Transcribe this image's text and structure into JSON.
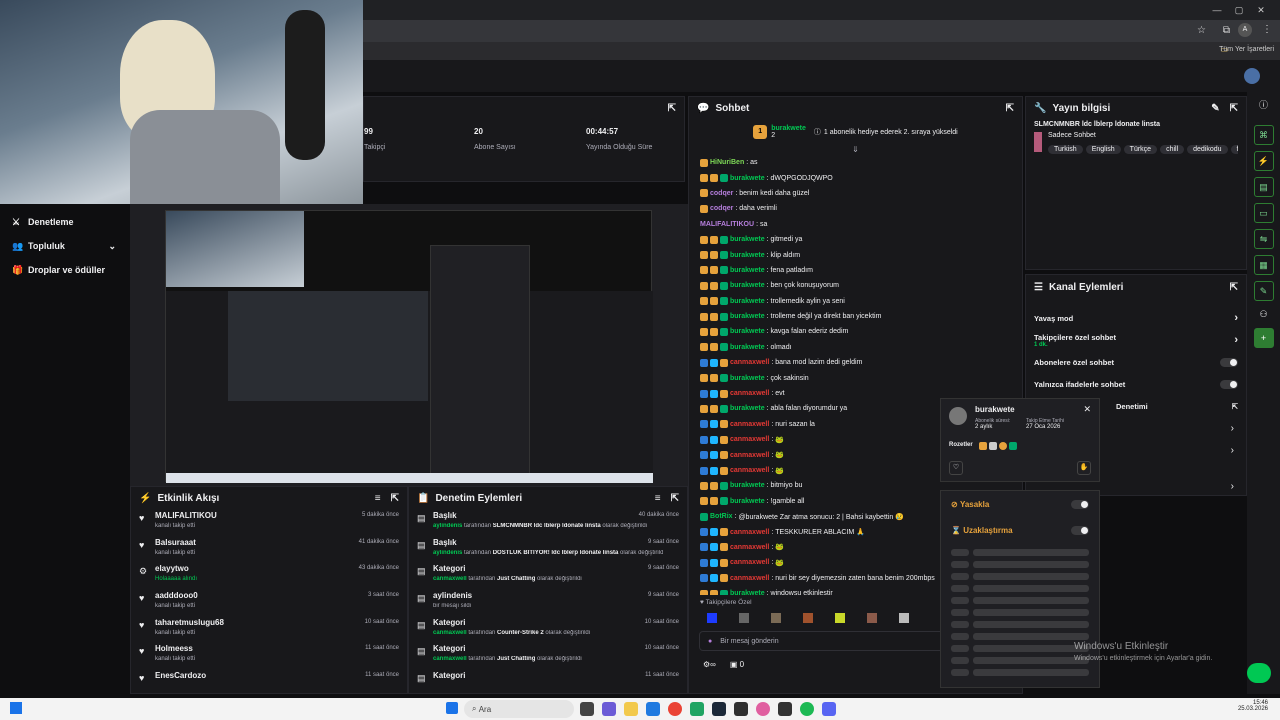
{
  "browser": {
    "bookmarks_label": "Tüm Yer İşaretleri",
    "window_controls": [
      "—",
      "▢",
      "✕"
    ]
  },
  "nav": {
    "items": [
      {
        "label": "Denetleme",
        "icon": "sword-icon"
      },
      {
        "label": "Topluluk",
        "icon": "people-icon"
      },
      {
        "label": "Droplar ve ödüller",
        "icon": "gift-icon"
      }
    ]
  },
  "stats": {
    "followers_value": "99",
    "followers_label": "Takipçi",
    "subs_value": "20",
    "subs_label": "Abone Sayısı",
    "uptime_value": "00:44:57",
    "uptime_label": "Yayında Olduğu Süre"
  },
  "activity": {
    "title": "Etkinlik Akışı",
    "items": [
      {
        "name": "MALIFALITIKOU",
        "sub": "kanalı takip etti",
        "time": "5 dakika önce",
        "icon": "heart"
      },
      {
        "name": "Balsuraaat",
        "sub": "kanalı takip etti",
        "time": "41 dakika önce",
        "icon": "heart"
      },
      {
        "name": "elayytwo",
        "sub": "Holaaaaa alındı",
        "time": "43 dakika önce",
        "icon": "reward"
      },
      {
        "name": "aadddooo0",
        "sub": "kanalı takip etti",
        "time": "3 saat önce",
        "icon": "heart"
      },
      {
        "name": "taharetmuslugu68",
        "sub": "kanalı takip etti",
        "time": "10 saat önce",
        "icon": "heart"
      },
      {
        "name": "Holmeess",
        "sub": "kanalı takip etti",
        "time": "11 saat önce",
        "icon": "heart"
      },
      {
        "name": "EnesCardozo",
        "sub": "",
        "time": "11 saat önce",
        "icon": "heart"
      }
    ]
  },
  "modlog": {
    "title": "Denetim Eylemleri",
    "items": [
      {
        "name": "Başlık",
        "actor": "aylindenis",
        "mid": " tarafından ",
        "target": "SLMCNMNBR ldc lblerp ldonate linsta",
        "end": " olarak değiştirildi",
        "time": "40 dakika önce"
      },
      {
        "name": "Başlık",
        "actor": "aylindenis",
        "mid": " tarafından ",
        "target": "DOSTLUK BİTİYOR! ldc lblerp ldonate linsta",
        "end": " olarak değiştirildi",
        "time": "9 saat önce"
      },
      {
        "name": "Kategori",
        "actor": "canmaxwell",
        "mid": " tarafından ",
        "target": "Just Chatting",
        "end": " olarak değiştirildi",
        "time": "9 saat önce"
      },
      {
        "name": "aylindenis",
        "actor": "",
        "mid": "bir mesajı sildi",
        "target": "",
        "end": "",
        "time": "9 saat önce"
      },
      {
        "name": "Kategori",
        "actor": "canmaxwell",
        "mid": " tarafından ",
        "target": "Counter-Strike 2",
        "end": " olarak değiştirildi",
        "time": "10 saat önce"
      },
      {
        "name": "Kategori",
        "actor": "canmaxwell",
        "mid": " tarafından ",
        "target": "Just Chatting",
        "end": " olarak değiştirildi",
        "time": "10 saat önce"
      },
      {
        "name": "Kategori",
        "actor": "",
        "mid": "",
        "target": "",
        "end": "",
        "time": "11 saat önce"
      }
    ]
  },
  "chat": {
    "title": "Sohbet",
    "pinned_user": "burakwete",
    "pinned_count": "2",
    "pinned_text": "1 abonelik hediye ederek 2. sıraya yükseldi",
    "messages": [
      {
        "user": "HiNuriBen",
        "color": "#7ed957",
        "text": "as",
        "badges": 1
      },
      {
        "user": "burakwete",
        "color": "#00c853",
        "text": "dWQPGODJQWPO",
        "badges": 3
      },
      {
        "user": "codqer",
        "color": "#b57edc",
        "text": "benim kedi daha güzel",
        "badges": 1
      },
      {
        "user": "codqer",
        "color": "#b57edc",
        "text": "daha verimli",
        "badges": 1
      },
      {
        "user": "MALIFALITIKOU",
        "color": "#b57edc",
        "text": "sa",
        "badges": 0
      },
      {
        "user": "burakwete",
        "color": "#00c853",
        "text": "gitmedi ya",
        "badges": 3
      },
      {
        "user": "burakwete",
        "color": "#00c853",
        "text": "klip aldım",
        "badges": 3
      },
      {
        "user": "burakwete",
        "color": "#00c853",
        "text": "fena patladım",
        "badges": 3
      },
      {
        "user": "burakwete",
        "color": "#00c853",
        "text": "ben çok konuşuyorum",
        "badges": 3
      },
      {
        "user": "burakwete",
        "color": "#00c853",
        "text": "trollemedik aylin ya seni",
        "badges": 3
      },
      {
        "user": "burakwete",
        "color": "#00c853",
        "text": "trolleme değil ya direkt ban yicektim",
        "badges": 3
      },
      {
        "user": "burakwete",
        "color": "#00c853",
        "text": "kavga falan ederiz dedim",
        "badges": 3
      },
      {
        "user": "burakwete",
        "color": "#00c853",
        "text": "olmadı",
        "badges": 3
      },
      {
        "user": "canmaxwell",
        "color": "#e53935",
        "text": "bana mod lazim dedi geldim",
        "badges": 4
      },
      {
        "user": "burakwete",
        "color": "#00c853",
        "text": "çok sakinsin",
        "badges": 3
      },
      {
        "user": "canmaxwell",
        "color": "#e53935",
        "text": "evt",
        "badges": 4
      },
      {
        "user": "burakwete",
        "color": "#00c853",
        "text": "abla falan diyorumdur ya",
        "badges": 3
      },
      {
        "user": "canmaxwell",
        "color": "#e53935",
        "text": "nuri sazan la",
        "badges": 4
      },
      {
        "user": "canmaxwell",
        "color": "#e53935",
        "text": "🐸",
        "badges": 4
      },
      {
        "user": "canmaxwell",
        "color": "#e53935",
        "text": "🐸",
        "badges": 4
      },
      {
        "user": "canmaxwell",
        "color": "#e53935",
        "text": "🐸",
        "badges": 4
      },
      {
        "user": "burakwete",
        "color": "#00c853",
        "text": "bitmiyo bu",
        "badges": 3
      },
      {
        "user": "burakwete",
        "color": "#00c853",
        "text": "!gamble all",
        "badges": 3
      },
      {
        "user": "BotRix",
        "color": "#00c853",
        "text": "@burakwete Zar atma sonucu: 2 | Bahsi kaybettin 😢",
        "badges": 2
      },
      {
        "user": "canmaxwell",
        "color": "#e53935",
        "text": "TESKKURLER ABLACIM 🙏",
        "badges": 4
      },
      {
        "user": "canmaxwell",
        "color": "#e53935",
        "text": "🐸",
        "badges": 4
      },
      {
        "user": "canmaxwell",
        "color": "#e53935",
        "text": "🐸",
        "badges": 4
      },
      {
        "user": "canmaxwell",
        "color": "#e53935",
        "text": "nuri bir sey diyemezsin zaten bana benim 200mbps",
        "badges": 4
      },
      {
        "user": "burakwete",
        "color": "#00c853",
        "text": "windowsu etkinleştir",
        "badges": 3
      }
    ],
    "followers_only_label": "Takipçilere Özel",
    "input_placeholder": "Bir mesaj gönderin",
    "points": "0"
  },
  "streaminfo": {
    "title": "Yayın bilgisi",
    "stream_title": "SLMCNMNBR ldc lblerp ldonate linsta",
    "category": "Sadece Sohbet",
    "tags": [
      "Turkish",
      "English",
      "Türkçe",
      "chill",
      "dedikodu",
      "fu"
    ]
  },
  "channel_actions": {
    "title": "Kanal Eylemleri",
    "items": [
      {
        "label": "Yavaş mod",
        "sub": "",
        "control": "arrow"
      },
      {
        "label": "Takipçilere özel sohbet",
        "sub": "1 dk.",
        "control": "arrow"
      },
      {
        "label": "Abonelere özel sohbet",
        "sub": "",
        "control": "toggle"
      },
      {
        "label": "Yalnızca ifadelerle sohbet",
        "sub": "",
        "control": "toggle"
      },
      {
        "label": "Denetimi",
        "sub": "",
        "control": "link"
      }
    ]
  },
  "usercard": {
    "name": "burakwete",
    "sub_label": "Abonelik süresi:",
    "sub_value": "2 aylık",
    "follow_label": "Takip Etme Tarihi",
    "follow_value": "27 Oca 2026",
    "badges_label": "Rozetler"
  },
  "modactions": {
    "ban": "Yasakla",
    "timeout": "Uzaklaştırma"
  },
  "watermark": {
    "title": "Windows'u Etkinleştir",
    "sub": "Windows'u etkinleştirmek için Ayarlar'a gidin."
  },
  "taskbar": {
    "search": "Ara",
    "time": "15:46",
    "date": "25.03.2026"
  },
  "colors": {
    "accent": "#53fc18",
    "panel": "#18181b",
    "bg": "#0e0e10"
  }
}
